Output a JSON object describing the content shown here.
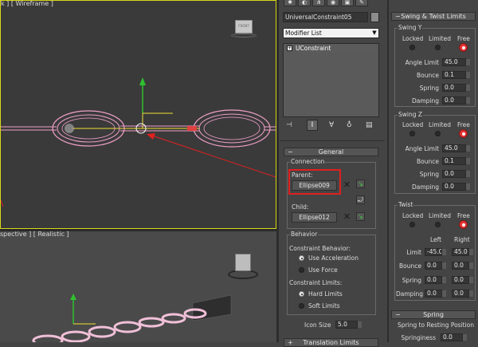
{
  "viewports": {
    "top_label": "k ] [ Wireframe ]",
    "bottom_label": "spective ] [ Realistic ]",
    "viewcube_label": "FRONT"
  },
  "command_panel": {
    "tabs": [
      "create-icon",
      "modify-icon",
      "hierarchy-icon",
      "motion-icon",
      "display-icon",
      "utilities-icon"
    ],
    "object_name": "UniversalConstraint05",
    "modifier_list": "Modifier List",
    "stack_item": "UConstraint",
    "general": {
      "title": "General",
      "connection_label": "Connection",
      "parent_label": "Parent:",
      "parent_value": "Ellipse009",
      "child_label": "Child:",
      "child_value": "Ellipse012",
      "behavior_label": "Behavior",
      "constraint_behavior_label": "Constraint Behavior:",
      "use_acceleration": "Use Acceleration",
      "use_force": "Use Force",
      "constraint_limits_label": "Constraint Limits:",
      "hard_limits": "Hard Limits",
      "soft_limits": "Soft Limits",
      "icon_size_label": "Icon Size",
      "icon_size_value": "5.0"
    },
    "next_rollout": "Translation Limits"
  },
  "swing_twist": {
    "title": "Swing & Twist Limits",
    "locked": "Locked",
    "limited": "Limited",
    "free": "Free",
    "swing_y": {
      "label": "Swing Y",
      "angle_limit_label": "Angle Limit",
      "angle_limit": "45.0",
      "bounce_label": "Bounce",
      "bounce": "0.1",
      "spring_label": "Spring",
      "spring": "0.0",
      "damping_label": "Damping",
      "damping": "0.0"
    },
    "swing_z": {
      "label": "Swing Z",
      "angle_limit_label": "Angle Limit",
      "angle_limit": "45.0",
      "bounce_label": "Bounce",
      "bounce": "0.1",
      "spring_label": "Spring",
      "spring": "0.0",
      "damping_label": "Damping",
      "damping": "0.0"
    },
    "twist": {
      "label": "Twist",
      "left_label": "Left",
      "right_label": "Right",
      "limit_label": "Limit",
      "limit_left": "-45.0",
      "limit_right": "45.0",
      "bounce_label": "Bounce",
      "bounce_left": "0.0",
      "bounce_right": "0.0",
      "spring_label": "Spring",
      "spring_left": "0.0",
      "spring_right": "0.0",
      "damping_label": "Damping",
      "damping_left": "0.0",
      "damping_right": "0.0"
    }
  },
  "spring": {
    "title": "Spring",
    "resting_label": "Spring to Resting Position",
    "springiness_label": "Springiness",
    "springiness": "0.0"
  },
  "colors": {
    "highlight": "#e02020",
    "active_viewport": "#d8d818",
    "wire": "#f0a0c8"
  }
}
